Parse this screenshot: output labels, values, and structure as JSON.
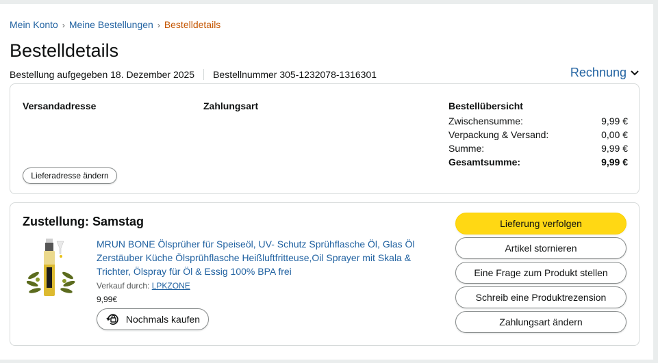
{
  "breadcrumb": {
    "items": [
      "Mein Konto",
      "Meine Bestellungen"
    ],
    "separator": "›",
    "current": "Bestelldetails"
  },
  "page_title": "Bestelldetails",
  "order_meta": {
    "placed": "Bestellung aufgegeben 18. Dezember 2025",
    "order_number": "Bestellnummer 305-1232078-1316301"
  },
  "rechnung_label": "Rechnung",
  "info_box": {
    "shipping_address_heading": "Versandadresse",
    "payment_heading": "Zahlungsart",
    "change_address_label": "Lieferadresse ändern",
    "summary": {
      "heading": "Bestellübersicht",
      "rows": [
        {
          "label": "Zwischensumme:",
          "value": "9,99 €"
        },
        {
          "label": "Verpackung & Versand:",
          "value": "0,00 €"
        },
        {
          "label": "Summe:",
          "value": "9,99 €"
        },
        {
          "label": "Gesamtsumme:",
          "value": "9,99 €"
        }
      ]
    }
  },
  "shipment": {
    "title": "Zustellung: Samstag",
    "product_title": "MRUN BONE Ölsprüher für Speiseöl, UV- Schutz Sprühflasche Öl, Glas Öl Zerstäuber Küche Ölsprühflasche Heißluftfritteuse,Oil Sprayer mit Skala & Trichter, Ölspray für Öl & Essig 100% BPA frei",
    "seller_prefix": "Verkauf durch:",
    "seller_name": "LPKZONE",
    "price": "9,99€",
    "buy_again_label": "Nochmals kaufen",
    "actions": [
      "Lieferung verfolgen",
      "Artikel stornieren",
      "Eine Frage zum Produkt stellen",
      "Schreib eine Produktrezension",
      "Zahlungsart ändern"
    ]
  },
  "colors": {
    "link": "#2162a1",
    "breadcrumb_current": "#c45500",
    "primary_button": "#ffd814"
  },
  "icons": [
    "chevron-down-icon",
    "buy-again-icon"
  ]
}
